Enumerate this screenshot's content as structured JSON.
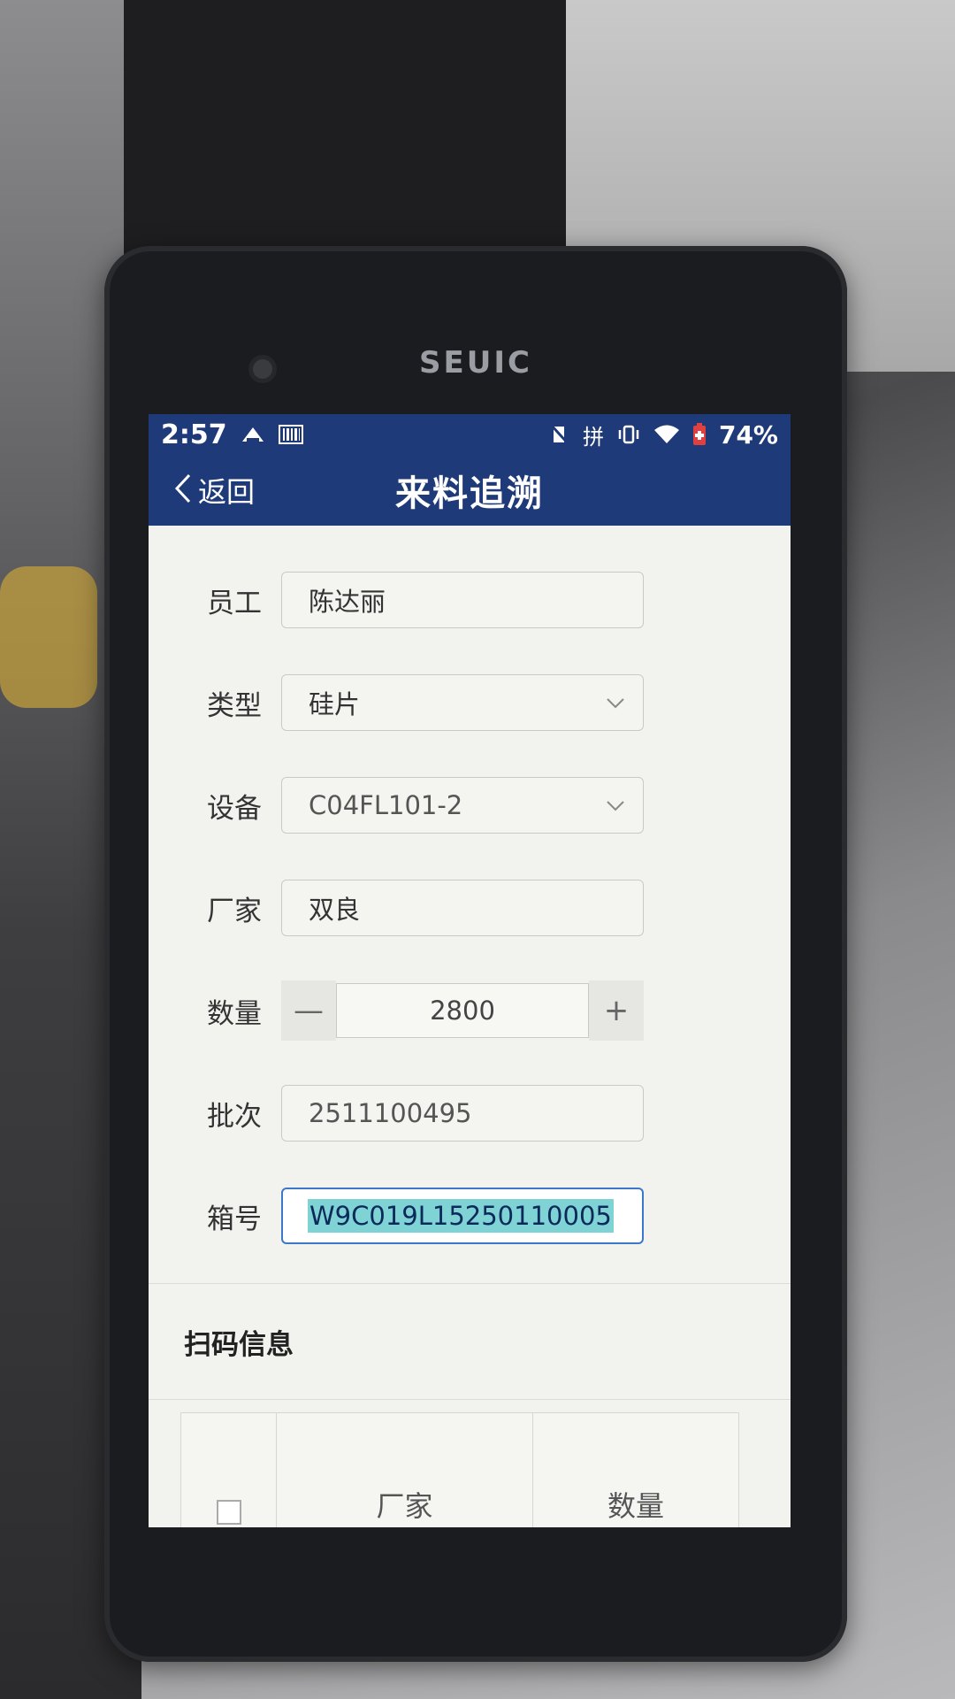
{
  "device": {
    "brand": "SEUIC"
  },
  "status_bar": {
    "time": "2:57",
    "ime": "拼",
    "battery": "74%"
  },
  "header": {
    "back_label": "返回",
    "title": "来料追溯"
  },
  "form": {
    "employee": {
      "label": "员工",
      "value": "陈达丽"
    },
    "type": {
      "label": "类型",
      "value": "硅片"
    },
    "equipment": {
      "label": "设备",
      "value": "C04FL101-2"
    },
    "manufacturer": {
      "label": "厂家",
      "value": "双良"
    },
    "quantity": {
      "label": "数量",
      "value": "2800",
      "minus": "—",
      "plus": "+"
    },
    "batch": {
      "label": "批次",
      "value": "2511100495"
    },
    "box": {
      "label": "箱号",
      "value": "W9C019L15250110005"
    }
  },
  "scan_section": {
    "title": "扫码信息",
    "columns": [
      "厂家",
      "数量"
    ]
  },
  "colors": {
    "header": "#1f3a78",
    "highlight": "#7fd3d5",
    "focus_border": "#3b78c9"
  },
  "icons": [
    "back-chevron-icon",
    "dropdown-chevron-icon",
    "mute-icon",
    "vibrate-icon",
    "wifi-icon",
    "battery-icon",
    "cast-icon",
    "barcode-icon"
  ]
}
